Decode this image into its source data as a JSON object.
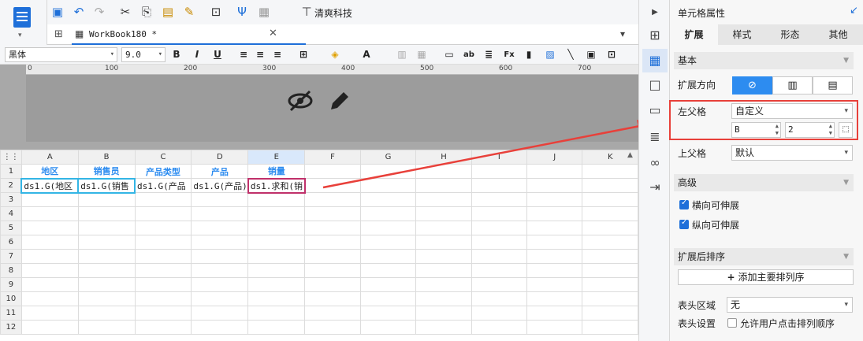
{
  "toolbar": {
    "company_label": "清爽科技"
  },
  "tabs": [
    {
      "label": "WorkBook180 *"
    }
  ],
  "format_bar": {
    "font_family": "黑体",
    "font_size": "9.0",
    "bold": "B",
    "italic": "I",
    "underline": "U"
  },
  "ruler": {
    "ticks": [
      "0",
      "100",
      "200",
      "300",
      "400",
      "500",
      "600",
      "700"
    ]
  },
  "grid": {
    "columns": [
      "A",
      "B",
      "C",
      "D",
      "E",
      "F",
      "G",
      "H",
      "I",
      "J",
      "K"
    ],
    "row_numbers": [
      "1",
      "2",
      "3",
      "4",
      "5",
      "6",
      "7",
      "8",
      "9",
      "10",
      "11",
      "12"
    ],
    "row1": [
      "地区",
      "销售员",
      "产品类型",
      "产品",
      "销量"
    ],
    "row2": [
      "ds1.G(地区",
      "ds1.G(销售",
      "ds1.G(产品",
      "ds1.G(产品)",
      "ds1.求和(销"
    ]
  },
  "panel": {
    "title": "单元格属性",
    "tabs": [
      "扩展",
      "样式",
      "形态",
      "其他"
    ],
    "basic_section": "基本",
    "expand_dir_label": "扩展方向",
    "left_parent_label": "左父格",
    "left_parent_value": "自定义",
    "left_parent_col": "B",
    "left_parent_row": "2",
    "upper_parent_label": "上父格",
    "upper_parent_value": "默认",
    "advanced_section": "高级",
    "h_expand": "横向可伸展",
    "v_expand": "纵向可伸展",
    "sort_section": "扩展后排序",
    "add_sort_button": "添加主要排列序",
    "header_area_label": "表头区域",
    "header_area_value": "无",
    "header_setting_label": "表头设置",
    "allow_sort": "允许用户点击排列顺序"
  },
  "colors": {
    "accent": "#1e6fd9",
    "header_text": "#2d8cf0",
    "highlight_red": "#e8403a"
  }
}
